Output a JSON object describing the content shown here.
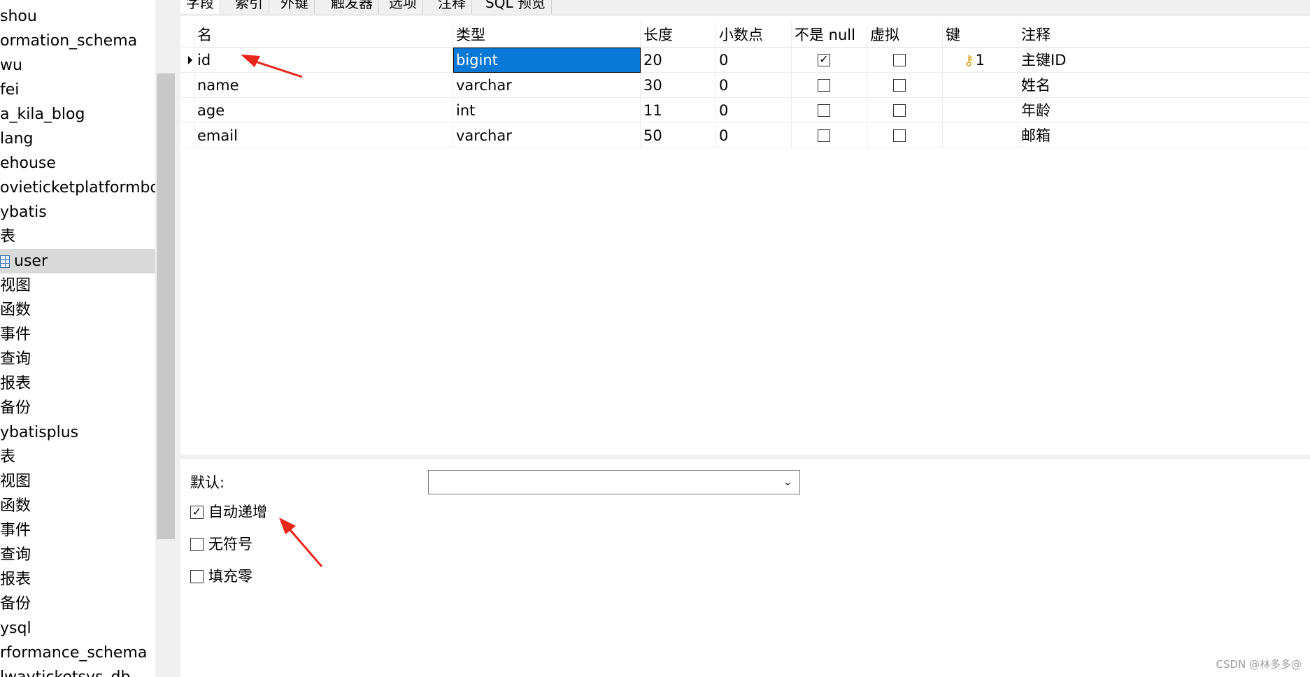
{
  "sidebar": {
    "items": [
      {
        "label": "shou"
      },
      {
        "label": "ormation_schema"
      },
      {
        "label": "wu"
      },
      {
        "label": "fei"
      },
      {
        "label": "a_kila_blog"
      },
      {
        "label": "lang"
      },
      {
        "label": "ehouse"
      },
      {
        "label": "ovieticketplatformboot"
      },
      {
        "label": "ybatis"
      },
      {
        "label": "表"
      },
      {
        "label": "user"
      },
      {
        "label": "视图"
      },
      {
        "label": "函数"
      },
      {
        "label": "事件"
      },
      {
        "label": "查询"
      },
      {
        "label": "报表"
      },
      {
        "label": "备份"
      },
      {
        "label": "ybatisplus"
      },
      {
        "label": "表"
      },
      {
        "label": "视图"
      },
      {
        "label": "函数"
      },
      {
        "label": "事件"
      },
      {
        "label": "查询"
      },
      {
        "label": "报表"
      },
      {
        "label": "备份"
      },
      {
        "label": "ysql"
      },
      {
        "label": "rformance_schema"
      },
      {
        "label": "lwayticketsys_db"
      }
    ]
  },
  "tabs": [
    {
      "label": "字段"
    },
    {
      "label": "索引"
    },
    {
      "label": "外键"
    },
    {
      "label": "触发器"
    },
    {
      "label": "选项"
    },
    {
      "label": "注释"
    },
    {
      "label": "SQL 预览"
    }
  ],
  "grid": {
    "headers": {
      "name": "名",
      "type": "类型",
      "length": "长度",
      "decimals": "小数点",
      "not_null": "不是 null",
      "virtual": "虚拟",
      "key": "键",
      "comment": "注释"
    },
    "rows": [
      {
        "name": "id",
        "type": "bigint",
        "length": "20",
        "decimals": "0",
        "not_null": true,
        "virtual": false,
        "key": "1",
        "comment": "主键ID"
      },
      {
        "name": "name",
        "type": "varchar",
        "length": "30",
        "decimals": "0",
        "not_null": false,
        "virtual": false,
        "key": "",
        "comment": "姓名"
      },
      {
        "name": "age",
        "type": "int",
        "length": "11",
        "decimals": "0",
        "not_null": false,
        "virtual": false,
        "key": "",
        "comment": "年龄"
      },
      {
        "name": "email",
        "type": "varchar",
        "length": "50",
        "decimals": "0",
        "not_null": false,
        "virtual": false,
        "key": "",
        "comment": "邮箱"
      }
    ]
  },
  "props": {
    "default_label": "默认:",
    "default_value": "",
    "options": [
      {
        "label": "自动递增",
        "checked": true
      },
      {
        "label": "无符号",
        "checked": false
      },
      {
        "label": "填充零",
        "checked": false
      }
    ]
  },
  "icons": {
    "key": "key-icon",
    "table": "table-icon",
    "row_indicator": "caret-right-icon",
    "dropdown": "chevron-down-icon"
  },
  "colors": {
    "selection": "#0a78d7",
    "annotation_arrow": "#e8251c"
  },
  "watermark": "CSDN @林多多@"
}
